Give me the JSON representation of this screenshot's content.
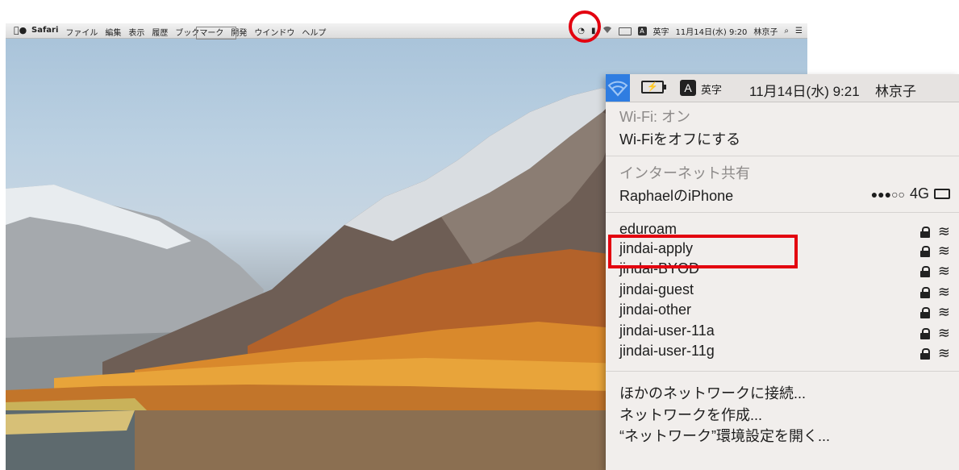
{
  "menubar": {
    "apple": "",
    "menus": [
      "Safari",
      "ファイル",
      "編集",
      "表示",
      "履歴",
      "ブックマーク",
      "開発",
      "ウインドウ",
      "ヘルプ"
    ],
    "input_label": "英字",
    "datetime": "11月14日(水) 9:20",
    "user": "林京子"
  },
  "zoomed": {
    "battery": "⚡",
    "input_mode": "A",
    "input_label": "英字",
    "datetime": "11月14日(水) 9:21",
    "user": "林京子",
    "wifi_status": "Wi-Fi: オン",
    "wifi_toggle": "Wi-Fiをオフにする",
    "hotspot_header": "インターネット共有",
    "hotspot": {
      "name": "RaphaelのiPhone",
      "signal": "●●●○○",
      "network": "4G"
    },
    "networks": [
      {
        "name": "eduroam",
        "locked": true
      },
      {
        "name": "jindai-apply",
        "locked": true
      },
      {
        "name": "jindai-BYOD",
        "locked": true
      },
      {
        "name": "jindai-guest",
        "locked": true
      },
      {
        "name": "jindai-other",
        "locked": true
      },
      {
        "name": "jindai-user-11a",
        "locked": true
      },
      {
        "name": "jindai-user-11g",
        "locked": true
      }
    ],
    "actions": [
      "ほかのネットワークに接続...",
      "ネットワークを作成...",
      "“ネットワーク”環境設定を開く..."
    ]
  },
  "highlight": {
    "color": "#e3000f",
    "target": "jindai-apply"
  },
  "accent": "#2f7de1"
}
